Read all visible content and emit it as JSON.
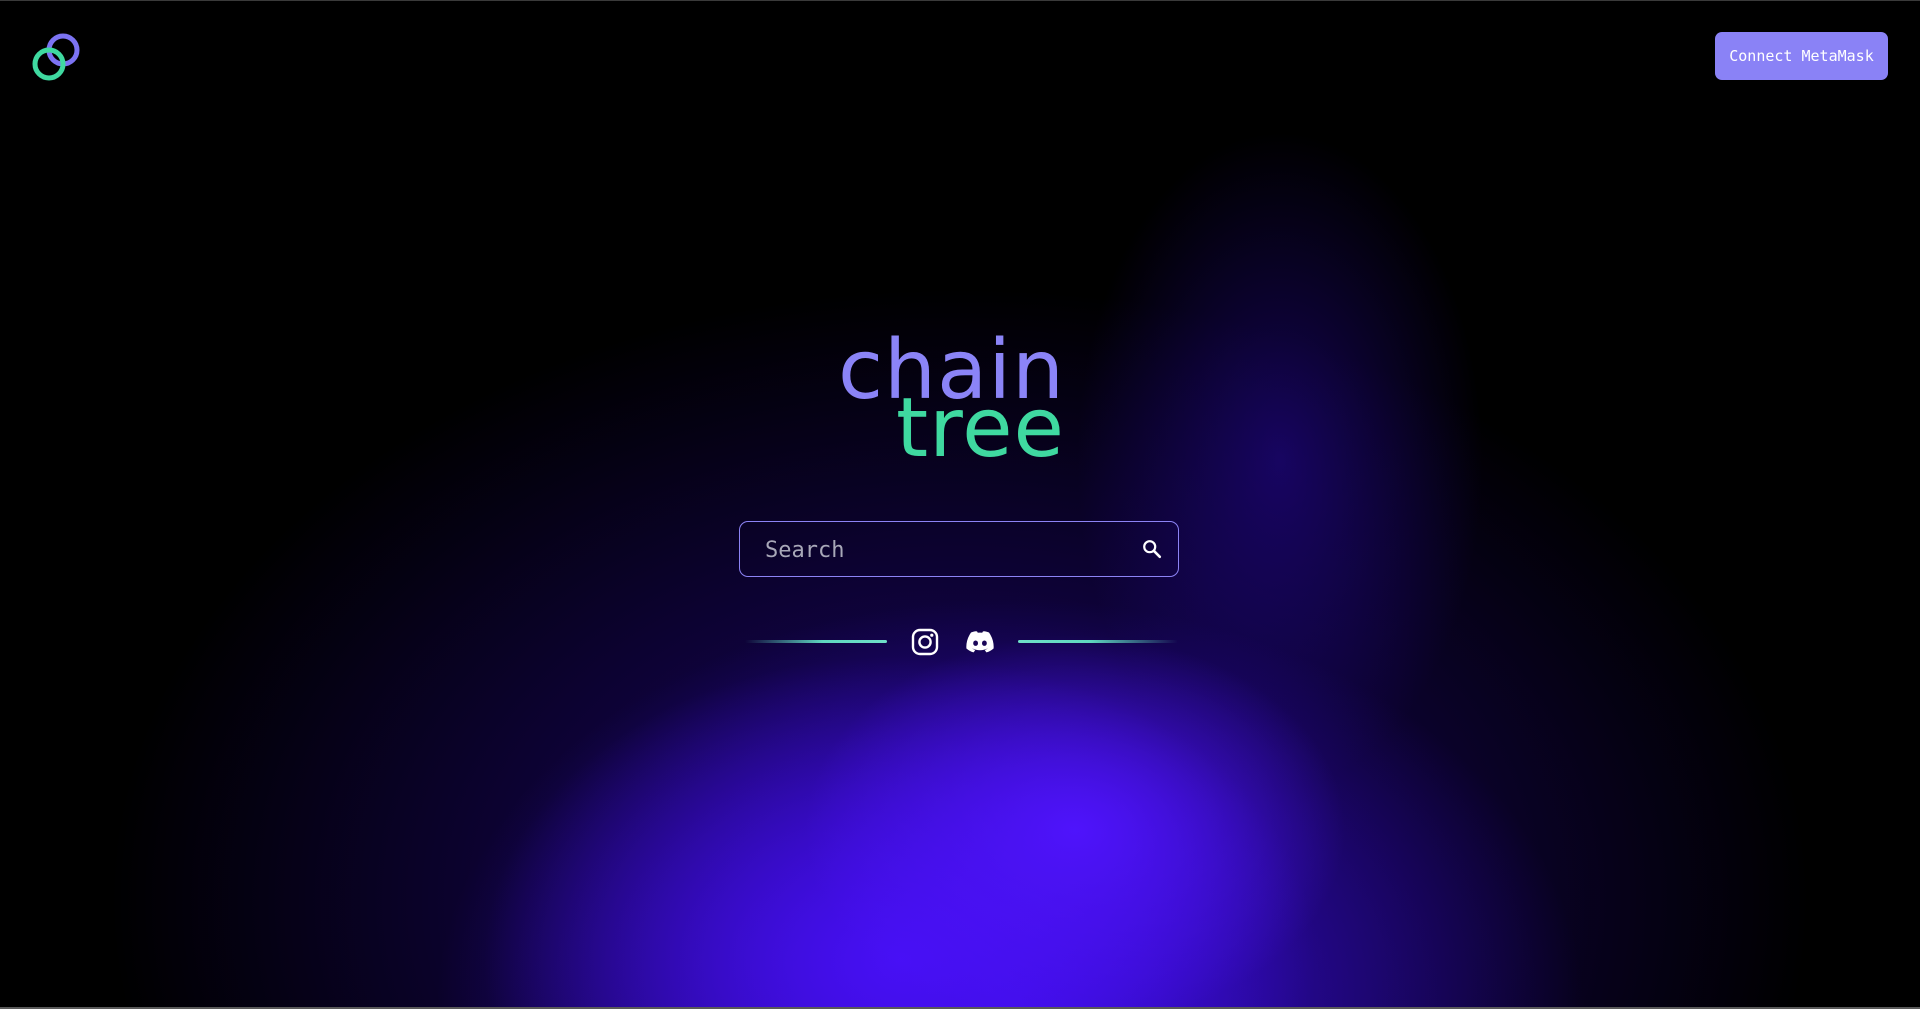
{
  "header": {
    "connect_button_label": "Connect MetaMask",
    "logo_icon": "chain-link-icon"
  },
  "brand": {
    "line1": "chain",
    "line2": "tree"
  },
  "search": {
    "placeholder": "Search",
    "value": "",
    "icon": "search-icon"
  },
  "social": {
    "icons": [
      "instagram-icon",
      "discord-icon"
    ]
  },
  "colors": {
    "accent_purple": "#8b84f7",
    "accent_green": "#3fd9a0",
    "button_bg": "#8a82f6",
    "background": "#000000",
    "glow": "#4a10ff"
  }
}
